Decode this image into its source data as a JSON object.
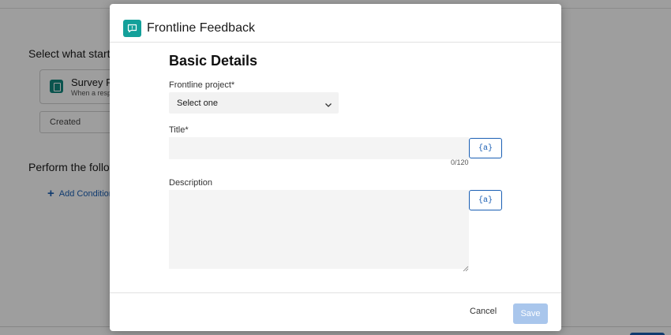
{
  "background": {
    "trigger_heading": "Select what starts",
    "trigger_card": {
      "title": "Survey Re",
      "subtitle": "When a resp"
    },
    "event_select": {
      "value": "Created"
    },
    "actions_heading": "Perform the follow",
    "add_condition_label": "Add Condition"
  },
  "modal": {
    "title": "Frontline Feedback",
    "icon": "chat-bubble-icon",
    "section_title": "Basic Details",
    "project_field": {
      "label": "Frontline project*",
      "value": "Select one"
    },
    "title_field": {
      "label": "Title*",
      "value": "",
      "counter": "0/120"
    },
    "description_field": {
      "label": "Description",
      "value": ""
    },
    "piped_text_label": "{a}",
    "footer": {
      "cancel_label": "Cancel",
      "save_label": "Save"
    }
  },
  "colors": {
    "accent": "#1a5fb4",
    "brand_teal": "#13a09a",
    "save_disabled": "#a9c6ec"
  }
}
